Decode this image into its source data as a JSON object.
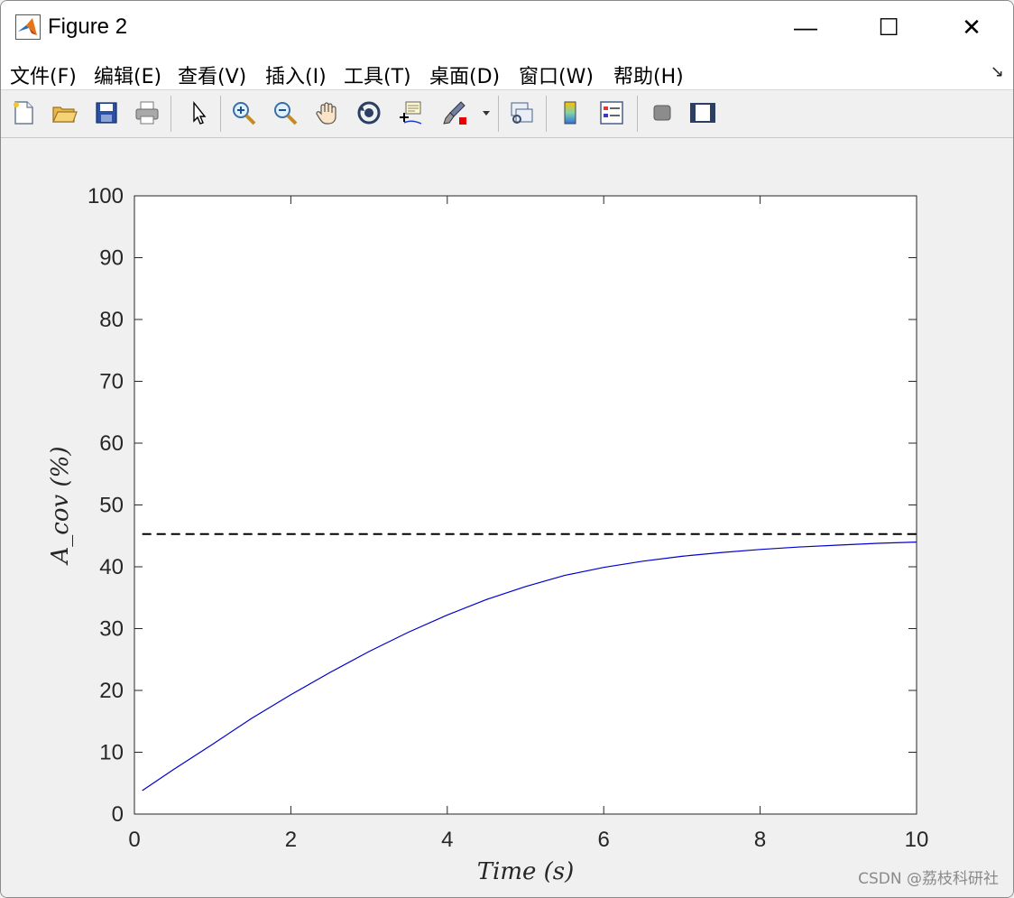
{
  "window": {
    "title": "Figure 2",
    "minimize_glyph": "—",
    "maximize_glyph": "☐",
    "close_glyph": "✕"
  },
  "menu": {
    "items": [
      {
        "label": "文件(F)"
      },
      {
        "label": "编辑(E)"
      },
      {
        "label": "查看(V)"
      },
      {
        "label": "插入(I)"
      },
      {
        "label": "工具(T)"
      },
      {
        "label": "桌面(D)"
      },
      {
        "label": "窗口(W)"
      },
      {
        "label": "帮助(H)"
      }
    ],
    "dock_glyph": "↘"
  },
  "toolbar": {
    "tools": [
      {
        "name": "new-figure-icon"
      },
      {
        "name": "open-file-icon"
      },
      {
        "name": "save-icon"
      },
      {
        "name": "print-icon"
      },
      {
        "name": "pointer-icon"
      },
      {
        "name": "zoom-in-icon"
      },
      {
        "name": "zoom-out-icon"
      },
      {
        "name": "pan-hand-icon"
      },
      {
        "name": "rotate-3d-icon"
      },
      {
        "name": "data-cursor-icon"
      },
      {
        "name": "brush-icon"
      },
      {
        "name": "dropdown-arrow-icon"
      },
      {
        "name": "link-plot-icon"
      },
      {
        "name": "colorbar-icon"
      },
      {
        "name": "legend-icon"
      },
      {
        "name": "hide-plot-tools-icon"
      },
      {
        "name": "show-plot-tools-icon"
      }
    ]
  },
  "chart_data": {
    "type": "line",
    "xlabel": "Time (s)",
    "ylabel": "A_cov (%)",
    "xlim": [
      0,
      10
    ],
    "ylim": [
      0,
      100
    ],
    "xticks": [
      0,
      2,
      4,
      6,
      8,
      10
    ],
    "yticks": [
      0,
      10,
      20,
      30,
      40,
      50,
      60,
      70,
      80,
      90,
      100
    ],
    "grid": false,
    "series": [
      {
        "color": "#0000cc",
        "style": "solid",
        "x": [
          0.1,
          0.5,
          1.0,
          1.5,
          2.0,
          2.5,
          3.0,
          3.5,
          4.0,
          4.5,
          5.0,
          5.5,
          6.0,
          6.5,
          7.0,
          7.5,
          8.0,
          8.5,
          9.0,
          9.5,
          10.0
        ],
        "y": [
          3.8,
          7.2,
          11.3,
          15.5,
          19.3,
          22.9,
          26.3,
          29.4,
          32.2,
          34.7,
          36.8,
          38.6,
          39.9,
          40.9,
          41.7,
          42.3,
          42.8,
          43.2,
          43.5,
          43.8,
          44.0
        ]
      },
      {
        "color": "#000000",
        "style": "dashed",
        "x": [
          0.1,
          10.0
        ],
        "y": [
          45.3,
          45.3
        ]
      }
    ]
  },
  "watermark": "CSDN @荔枝科研社"
}
